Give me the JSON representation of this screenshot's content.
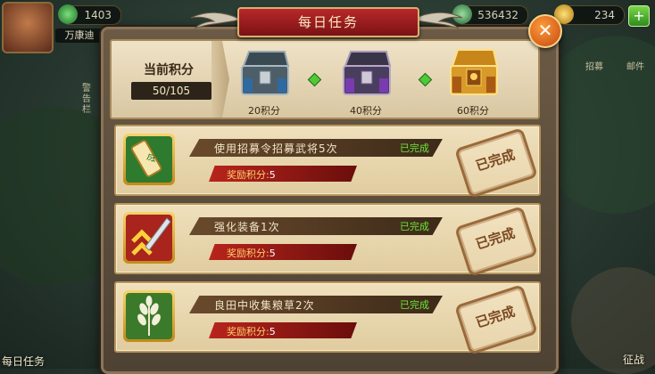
{
  "hud": {
    "jade": "1403",
    "player_name": "万康迪",
    "coins": "536432",
    "gold": "234"
  },
  "side": {
    "left_label": "警告栏",
    "right_tab": "招募",
    "right_tab2": "邮件"
  },
  "bottom": {
    "left_label": "每日任务",
    "right_label": "征战"
  },
  "dialog": {
    "title": "每日任务",
    "close_glyph": "✕"
  },
  "progress": {
    "label": "当前积分",
    "value": "50/105",
    "chests": [
      {
        "label": "20积分",
        "icon": "silver-chest-icon"
      },
      {
        "label": "40积分",
        "icon": "purple-chest-icon"
      },
      {
        "label": "60积分",
        "icon": "gold-chest-icon"
      }
    ]
  },
  "tasks": [
    {
      "name": "使用招募令招募武将5次",
      "status": "已完成",
      "reward_label": "奖励积分:",
      "reward_value": "5",
      "stamp": "已完成",
      "icon": "recruit-token-icon"
    },
    {
      "name": "强化装备1次",
      "status": "已完成",
      "reward_label": "奖励积分:",
      "reward_value": "5",
      "stamp": "已完成",
      "icon": "upgrade-sword-icon"
    },
    {
      "name": "良田中收集粮草2次",
      "status": "已完成",
      "reward_label": "奖励积分:",
      "reward_value": "5",
      "stamp": "已完成",
      "icon": "wheat-icon"
    }
  ],
  "colors": {
    "accent": "#b8282a",
    "complete": "#6ae63a",
    "panel": "#efe0bc"
  }
}
